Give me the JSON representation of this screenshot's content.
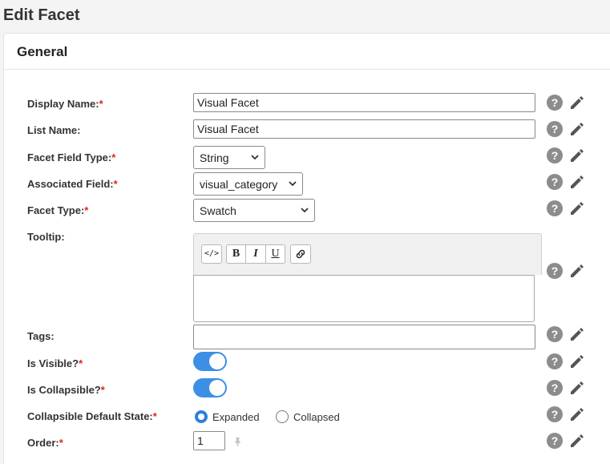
{
  "page": {
    "title": "Edit Facet"
  },
  "panel": {
    "title": "General"
  },
  "fields": {
    "display_name": {
      "label": "Display Name:",
      "required": "*",
      "value": "Visual Facet"
    },
    "list_name": {
      "label": "List Name:",
      "value": "Visual Facet"
    },
    "facet_field_type": {
      "label": "Facet Field Type:",
      "required": "*",
      "value": "String"
    },
    "associated_field": {
      "label": "Associated Field:",
      "required": "*",
      "value": "visual_category"
    },
    "facet_type": {
      "label": "Facet Type:",
      "required": "*",
      "value": "Swatch"
    },
    "tooltip": {
      "label": "Tooltip:"
    },
    "tags": {
      "label": "Tags:",
      "value": ""
    },
    "is_visible": {
      "label": "Is Visible?",
      "required": "*",
      "on": true
    },
    "is_collapsible": {
      "label": "Is Collapsible?",
      "required": "*",
      "on": true
    },
    "collapsible_default_state": {
      "label": "Collapsible Default State:",
      "required": "*",
      "options": [
        "Expanded",
        "Collapsed"
      ],
      "selected": "Expanded"
    },
    "order": {
      "label": "Order:",
      "required": "*",
      "value": "1"
    }
  },
  "editor_toolbar": {
    "source": "</>",
    "bold": "B",
    "italic": "I",
    "underline": "U"
  },
  "help_glyph": "?",
  "icons": [
    "help-icon",
    "pencil-icon",
    "chevron-down-icon",
    "link-icon",
    "pin-icon"
  ],
  "colors": {
    "accent": "#3d8fe6",
    "required": "#d9271f",
    "help": "#8c8c8c"
  }
}
